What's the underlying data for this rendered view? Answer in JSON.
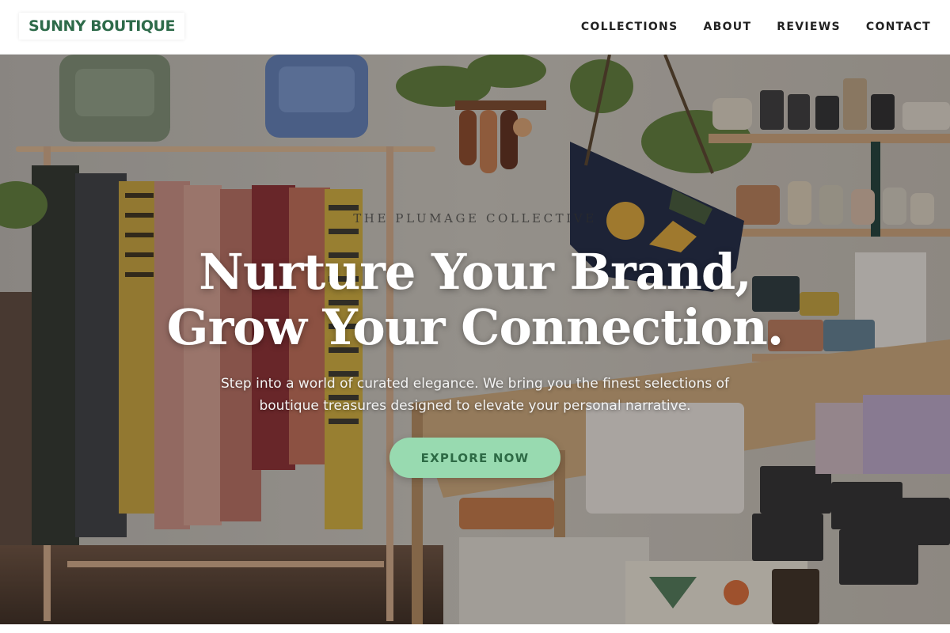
{
  "brand": {
    "name": "SUNNY BOUTIQUE",
    "color": "#2e6b4a"
  },
  "nav": {
    "items": [
      {
        "label": "COLLECTIONS"
      },
      {
        "label": "ABOUT"
      },
      {
        "label": "REVIEWS"
      },
      {
        "label": "CONTACT"
      }
    ]
  },
  "hero": {
    "eyebrow": "THE PLUMAGE COLLECTIVE",
    "headline_line1": "Nurture Your Brand,",
    "headline_line2": "Grow Your Connection.",
    "subtext": "Step into a world of curated elegance. We bring you the finest selections of boutique treasures designed to elevate your personal narrative.",
    "cta_label": "EXPLORE NOW",
    "cta_color": "#98dab0",
    "background_image": "boutique-interior-photo"
  }
}
